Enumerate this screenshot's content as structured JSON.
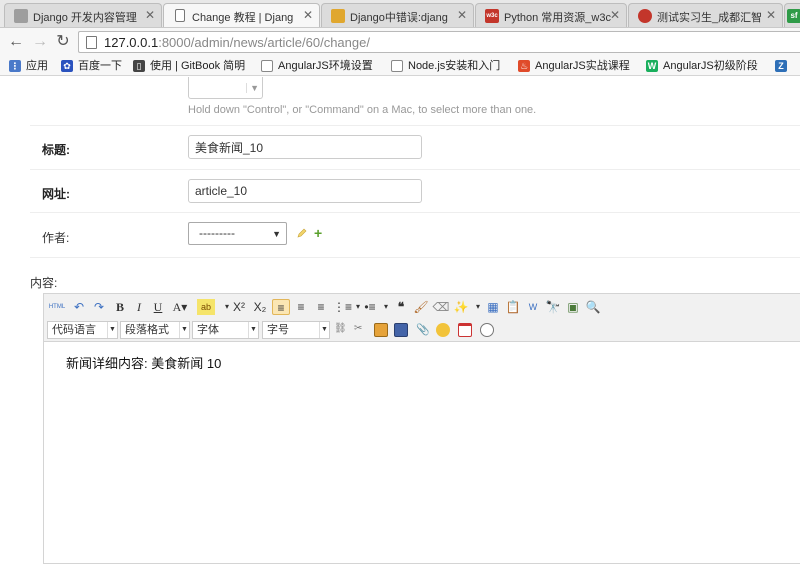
{
  "browser": {
    "tabs": [
      {
        "title": "Django 开发内容管理",
        "icon": "page-icon",
        "color": "#9e9e9e"
      },
      {
        "title": "Change 教程 | Djang",
        "icon": "doc-icon",
        "color": "#ffffff"
      },
      {
        "title": "Django中错误:djang",
        "icon": "folder-icon",
        "color": "#e0a72e"
      },
      {
        "title": "Python 常用资源_w3c",
        "icon": "w3c-icon",
        "color": "#c3362b"
      },
      {
        "title": "测试实习生_成都汇智",
        "icon": "bird-icon",
        "color": "#c3362b"
      },
      {
        "title": "sf",
        "icon": "sf-icon",
        "color": "#2f9b48"
      }
    ],
    "url_host": "127.0.0.1",
    "url_rest": ":8000/admin/news/article/60/change/",
    "bookmarks": [
      {
        "label": "应用",
        "icon": "apps-icon",
        "color": "#4a79c9"
      },
      {
        "label": "百度一下",
        "icon": "baidu-icon",
        "color": "#2a52be"
      },
      {
        "label": "使用 | GitBook 简明",
        "icon": "book-icon",
        "color": "#444444"
      },
      {
        "label": "AngularJS环境设置",
        "icon": "page-icon",
        "color": "#888888"
      },
      {
        "label": "Node.js安装和入门",
        "icon": "page-icon",
        "color": "#888888"
      },
      {
        "label": "AngularJS实战课程",
        "icon": "fire-icon",
        "color": "#e04b2a"
      },
      {
        "label": "AngularJS初级阶段",
        "icon": "w-icon",
        "color": "#1aaf5d"
      },
      {
        "label": "Z",
        "icon": "z-icon",
        "color": "#2e6fb7"
      }
    ]
  },
  "form": {
    "help_text": "Hold down \"Control\", or \"Command\" on a Mac, to select more than one.",
    "title_label": "标题:",
    "title_value": "美食新闻_10",
    "url_label": "网址:",
    "url_value": "article_10",
    "author_label": "作者:",
    "author_value": "---------",
    "content_label": "内容:"
  },
  "editor": {
    "combos": [
      "代码语言",
      "段落格式",
      "字体",
      "字号"
    ],
    "body_text": "新闻详细内容: 美食新闻 10"
  }
}
